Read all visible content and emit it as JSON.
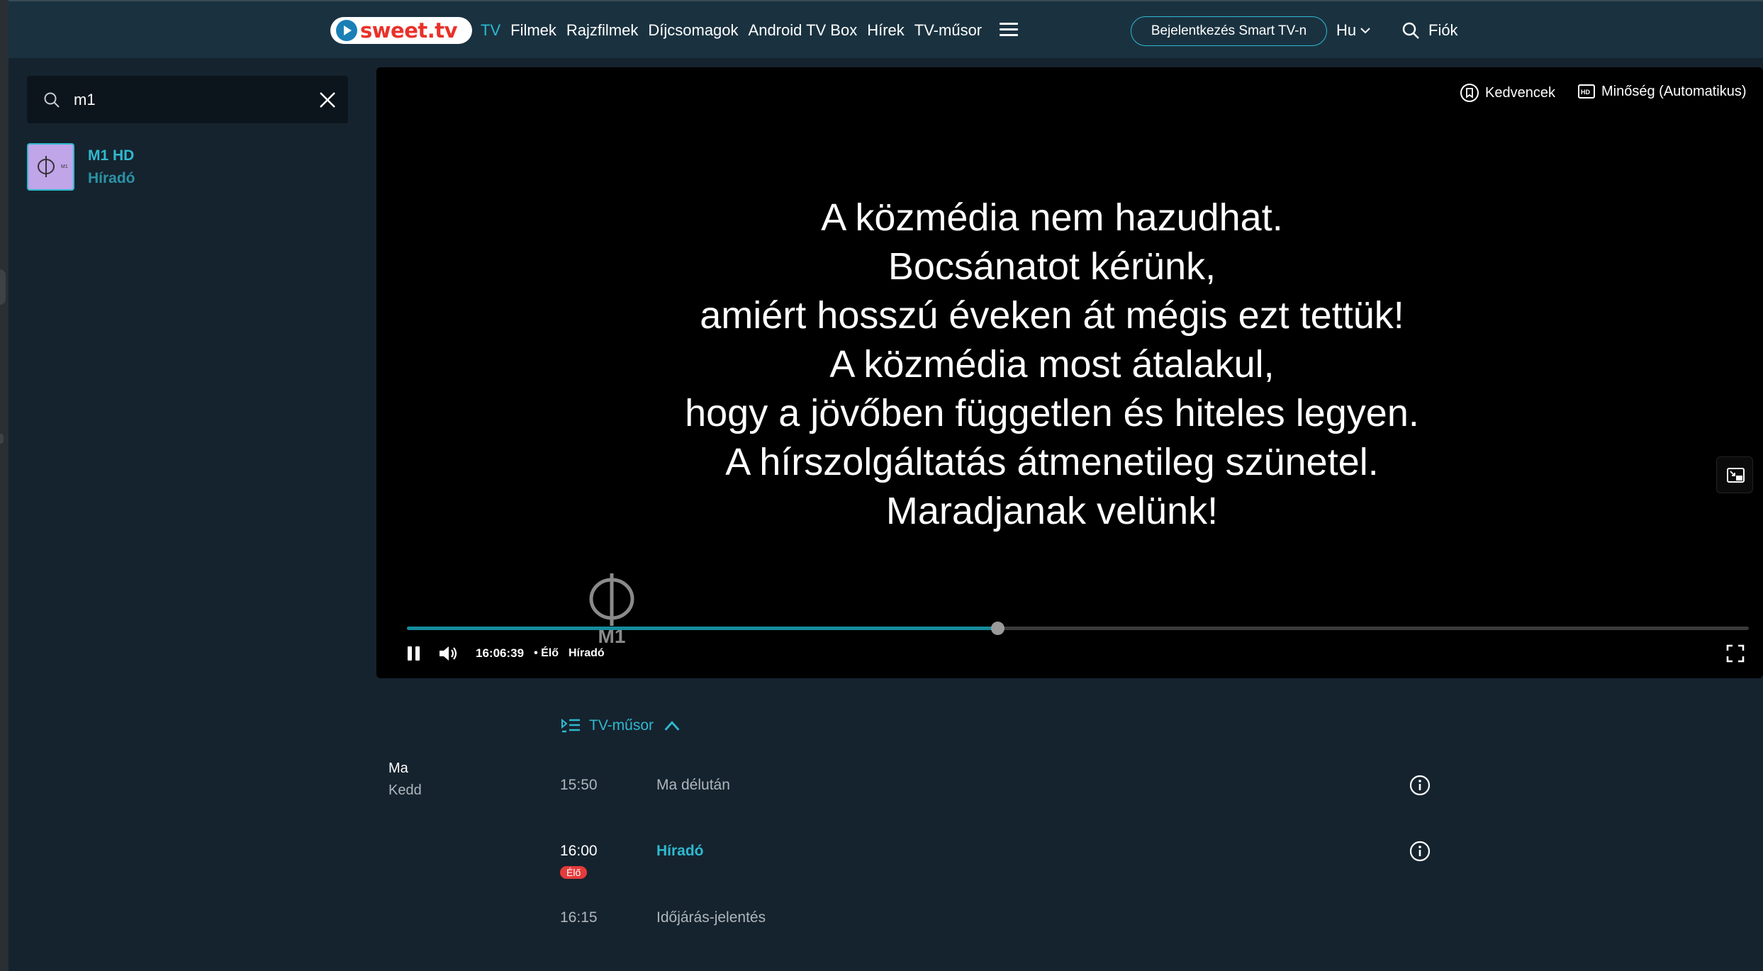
{
  "header": {
    "logo_text": "sweet.tv",
    "nav": [
      {
        "label": "TV",
        "active": true
      },
      {
        "label": "Filmek",
        "active": false
      },
      {
        "label": "Rajzfilmek",
        "active": false
      },
      {
        "label": "Díjcsomagok",
        "active": false
      },
      {
        "label": "Android TV Box",
        "active": false
      },
      {
        "label": "Hírek",
        "active": false
      },
      {
        "label": "TV-műsor",
        "active": false
      }
    ],
    "menu_icon": "hamburger-icon",
    "smart_tv_button": "Bejelentkezés Smart TV-n",
    "language": "Hu",
    "search_icon": "search-icon",
    "account": "Fiók"
  },
  "sidebar": {
    "search_value": "m1",
    "results": [
      {
        "title": "M1 HD",
        "subtitle": "Híradó"
      }
    ]
  },
  "player": {
    "favorites_label": "Kedvencek",
    "quality_label": "Minőség (Automatikus)",
    "message_lines": [
      "A közmédia nem hazudhat.",
      "Bocsánatot kérünk,",
      "amiért hosszú éveken át mégis ezt tettük!",
      "A közmédia most átalakul,",
      "hogy a jövőben független és hiteles legyen.",
      "A hírszolgáltatás átmenetileg szünetel.",
      "Maradjanak velünk!"
    ],
    "channel_logo_text": "M1",
    "progress_fraction": 0.44,
    "time": "16:06:39",
    "live_label": "• Élő",
    "program": "Híradó"
  },
  "schedule": {
    "toggle_label": "TV-műsor",
    "day_label": "Ma",
    "weekday": "Kedd",
    "items": [
      {
        "time": "15:50",
        "title": "Ma délután",
        "live": false,
        "badge": ""
      },
      {
        "time": "16:00",
        "title": "Híradó",
        "live": true,
        "badge": "Élő"
      },
      {
        "time": "16:15",
        "title": "Időjárás-jelentés",
        "live": false,
        "badge": ""
      }
    ]
  },
  "colors": {
    "accent": "#2fb9d0",
    "header_bg": "#1a3240",
    "page_bg": "#15232e",
    "live_badge": "#e43b3b",
    "logo_red": "#e8322a"
  }
}
